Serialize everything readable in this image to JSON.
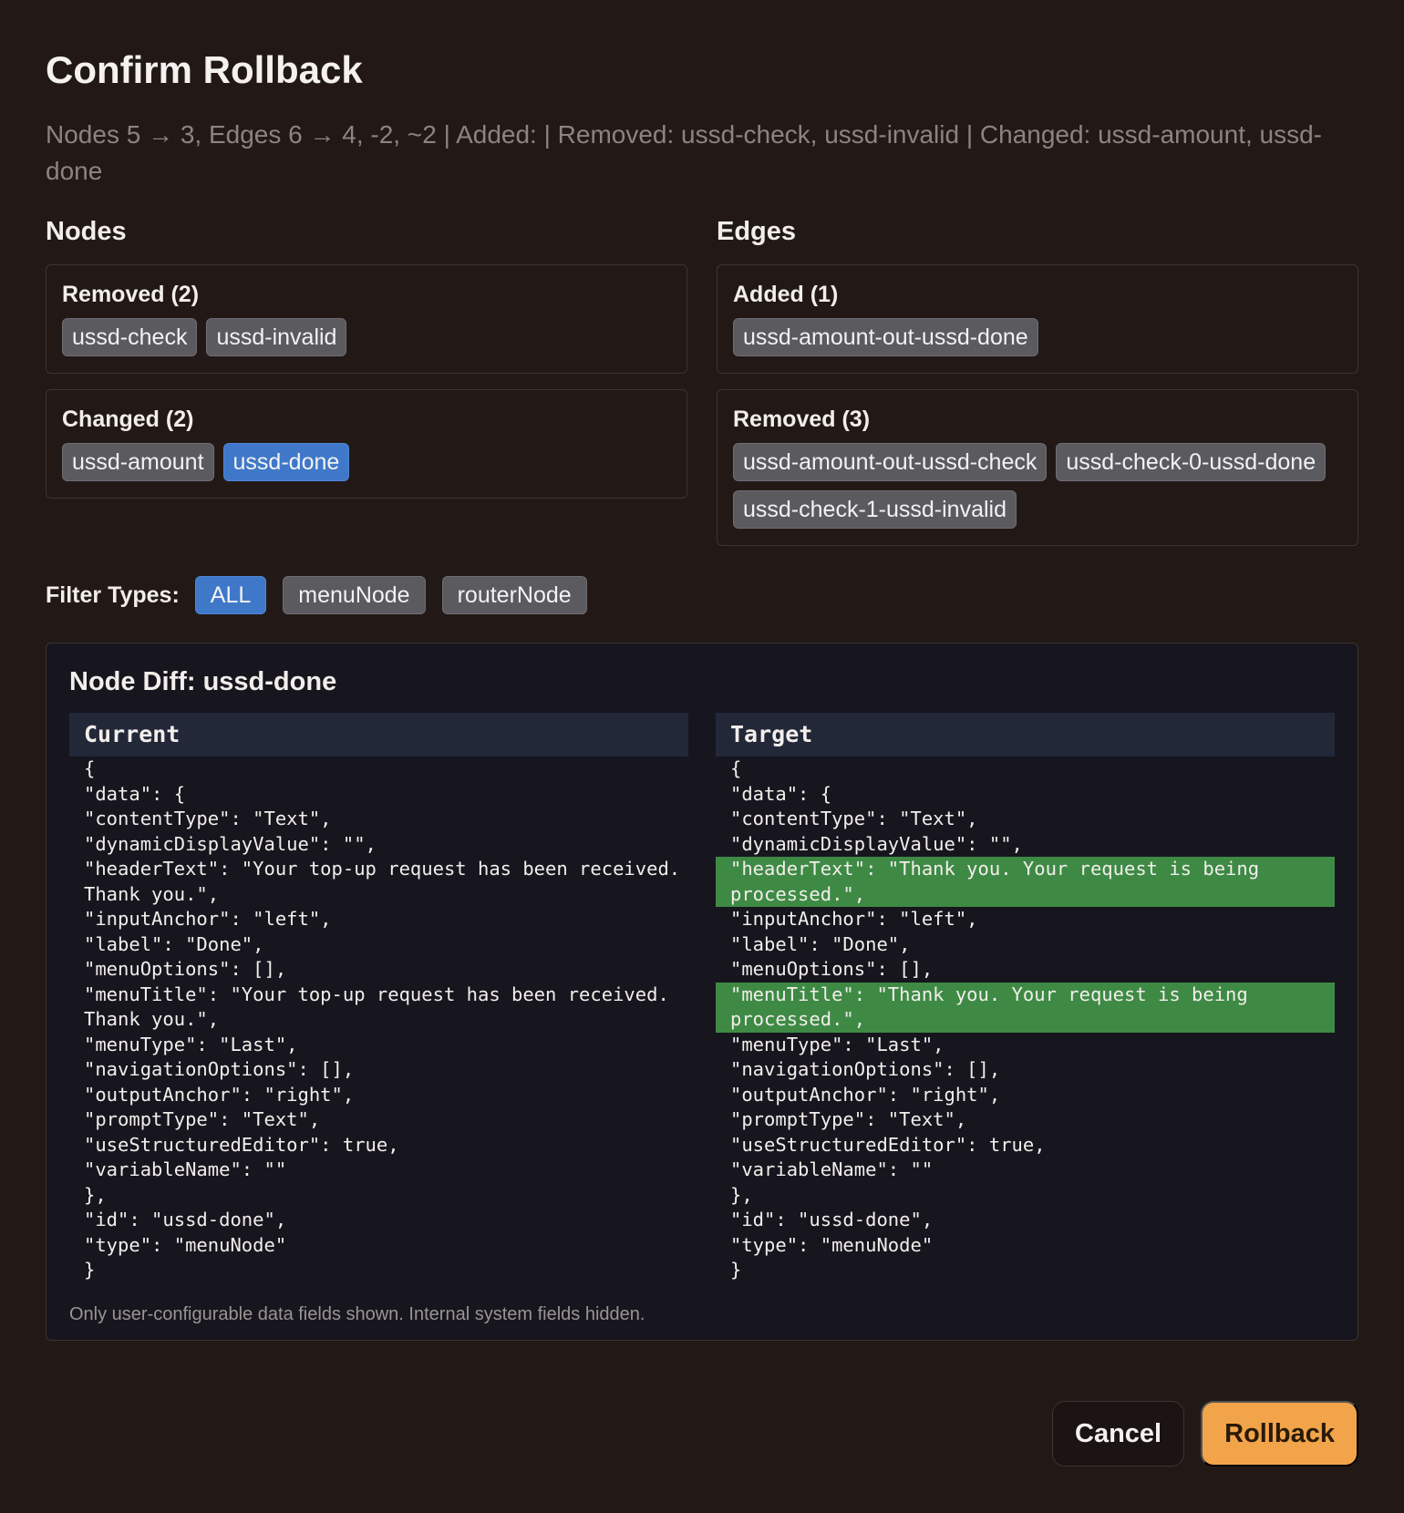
{
  "dialog": {
    "title": "Confirm Rollback",
    "summary": "Nodes 5 → 3, Edges 6 → 4, -2, ~2 | Added:  | Removed: ussd-check, ussd-invalid | Changed: ussd-amount, ussd-done"
  },
  "nodes": {
    "heading": "Nodes",
    "removed": {
      "label": "Removed (2)",
      "items": [
        "ussd-check",
        "ussd-invalid"
      ]
    },
    "changed": {
      "label": "Changed (2)",
      "items": [
        "ussd-amount",
        "ussd-done"
      ],
      "active": "ussd-done"
    }
  },
  "edges": {
    "heading": "Edges",
    "added": {
      "label": "Added (1)",
      "items": [
        "ussd-amount-out-ussd-done"
      ]
    },
    "removed": {
      "label": "Removed (3)",
      "items": [
        "ussd-amount-out-ussd-check",
        "ussd-check-0-ussd-done",
        "ussd-check-1-ussd-invalid"
      ]
    }
  },
  "filters": {
    "label": "Filter Types:",
    "options": [
      "ALL",
      "menuNode",
      "routerNode"
    ],
    "active": "ALL"
  },
  "diff": {
    "title": "Node Diff: ussd-done",
    "current": {
      "label": "Current",
      "lines": [
        "{",
        "\"data\": {",
        "\"contentType\": \"Text\",",
        "\"dynamicDisplayValue\": \"\",",
        "\"headerText\": \"Your top-up request has been received. Thank you.\",",
        "\"inputAnchor\": \"left\",",
        "\"label\": \"Done\",",
        "\"menuOptions\": [],",
        "\"menuTitle\": \"Your top-up request has been received. Thank you.\",",
        "\"menuType\": \"Last\",",
        "\"navigationOptions\": [],",
        "\"outputAnchor\": \"right\",",
        "\"promptType\": \"Text\",",
        "\"useStructuredEditor\": true,",
        "\"variableName\": \"\"",
        "},",
        "\"id\": \"ussd-done\",",
        "\"type\": \"menuNode\"",
        "}"
      ]
    },
    "target": {
      "label": "Target",
      "lines": [
        "{",
        "\"data\": {",
        "\"contentType\": \"Text\",",
        "\"dynamicDisplayValue\": \"\",",
        "\"headerText\": \"Thank you. Your request is being processed.\",",
        "\"inputAnchor\": \"left\",",
        "\"label\": \"Done\",",
        "\"menuOptions\": [],",
        "\"menuTitle\": \"Thank you. Your request is being processed.\",",
        "\"menuType\": \"Last\",",
        "\"navigationOptions\": [],",
        "\"outputAnchor\": \"right\",",
        "\"promptType\": \"Text\",",
        "\"useStructuredEditor\": true,",
        "\"variableName\": \"\"",
        "},",
        "\"id\": \"ussd-done\",",
        "\"type\": \"menuNode\"",
        "}"
      ],
      "highlighted": [
        4,
        8
      ]
    },
    "note": "Only user-configurable data fields shown. Internal system fields hidden."
  },
  "actions": {
    "cancel": "Cancel",
    "confirm": "Rollback"
  },
  "colors": {
    "accent": "#3f78c8",
    "primary": "#f2a44a",
    "diff_highlight": "#3e8a45"
  }
}
